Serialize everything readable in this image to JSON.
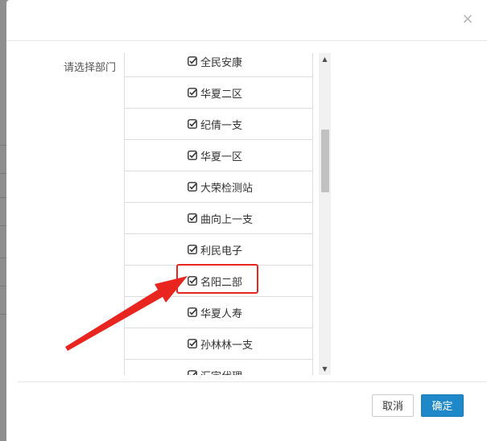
{
  "dialog": {
    "close_glyph": "×",
    "field_label": "请选择部门",
    "departments": [
      {
        "label": "全民安康",
        "checked": true
      },
      {
        "label": "华夏二区",
        "checked": true
      },
      {
        "label": "纪倩一支",
        "checked": true
      },
      {
        "label": "华夏一区",
        "checked": true
      },
      {
        "label": "大荣检测站",
        "checked": true
      },
      {
        "label": "曲向上一支",
        "checked": true
      },
      {
        "label": "利民电子",
        "checked": true
      },
      {
        "label": "名阳二部",
        "checked": true
      },
      {
        "label": "华夏人寿",
        "checked": true
      },
      {
        "label": "孙林林一支",
        "checked": true
      },
      {
        "label": "汇宇代理",
        "checked": true
      }
    ],
    "highlighted_item": "名阳二部",
    "cancel_label": "取消",
    "ok_label": "确定"
  },
  "colors": {
    "annotation": "#e8261f",
    "primary": "#1e88c8"
  },
  "icons": {
    "check": "checkbox-checked-icon",
    "close": "close-icon",
    "scroll_up": "scroll-up-arrow-icon",
    "scroll_down": "scroll-down-arrow-icon"
  }
}
